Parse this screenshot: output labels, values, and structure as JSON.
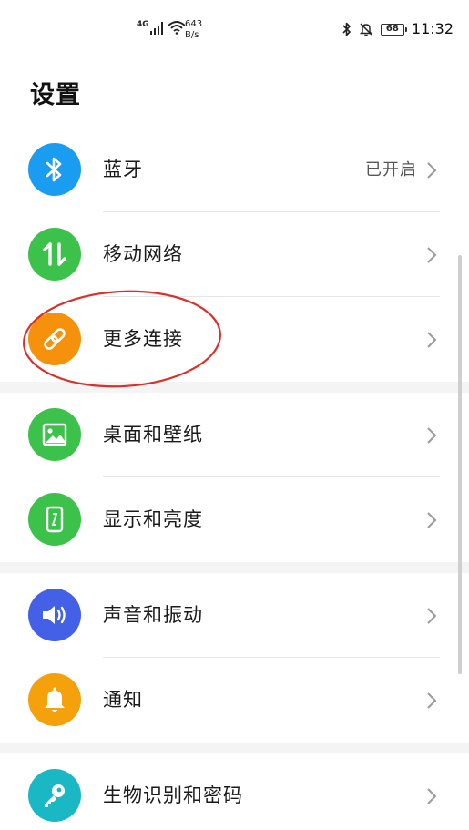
{
  "status_bar": {
    "network_type": "4G",
    "speed_value": "643",
    "speed_unit": "B/s",
    "battery": "68",
    "battery_level": 0.68,
    "time": "11:32"
  },
  "page": {
    "title": "设置"
  },
  "settings": {
    "bluetooth": {
      "label": "蓝牙",
      "value": "已开启",
      "icon": "bluetooth-icon",
      "color": "#1a9cf0"
    },
    "mobile_network": {
      "label": "移动网络",
      "icon": "mobile-data-icon",
      "color": "#3cc24a"
    },
    "more_connections": {
      "label": "更多连接",
      "icon": "link-icon",
      "color": "#f5910b"
    },
    "wallpaper": {
      "label": "桌面和壁纸",
      "icon": "image-icon",
      "color": "#3cc24a"
    },
    "display": {
      "label": "显示和亮度",
      "icon": "phone-brightness-icon",
      "color": "#3cc24a"
    },
    "sound": {
      "label": "声音和振动",
      "icon": "speaker-icon",
      "color": "#4460e6"
    },
    "notifications": {
      "label": "通知",
      "icon": "bell-icon",
      "color": "#f5a10c"
    },
    "biometrics": {
      "label": "生物识别和密码",
      "icon": "key-icon",
      "color": "#1ab8c4"
    }
  },
  "annotation": {
    "highlight_color": "#d9302c"
  }
}
